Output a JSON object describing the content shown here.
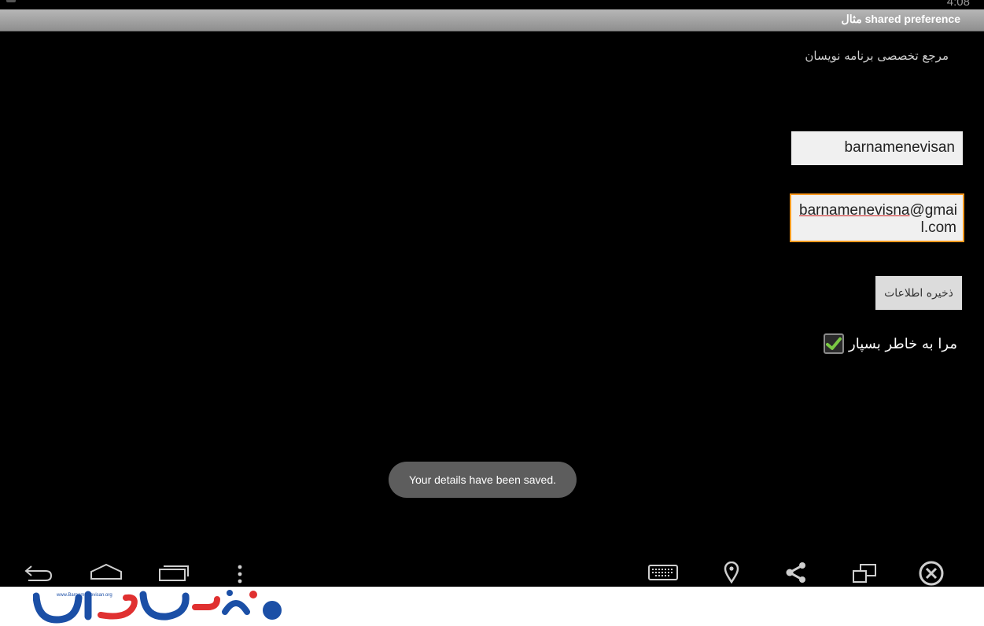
{
  "status_bar": {
    "clock": "4:08"
  },
  "app_bar": {
    "title": "مثال shared preference"
  },
  "main": {
    "subtitle": "مرجع تخصصی برنامه نویسان",
    "name_value": "barnamenevisan",
    "email_value_line1_underlined": "barnamenevisna",
    "email_value_line1_rest": "@gmai",
    "email_value_line2": "l.com",
    "save_button_label": "ذخیره اطلاعات",
    "remember_label": "مرا به خاطر بسپار",
    "remember_checked": true
  },
  "toast": {
    "message": "Your details have been saved."
  },
  "nav_bar": {
    "left_icons": [
      "back-icon",
      "home-icon",
      "recent-apps-icon",
      "menu-icon"
    ],
    "right_icons": [
      "keyboard-icon",
      "location-icon",
      "share-icon",
      "screen-rotate-icon",
      "close-icon"
    ]
  },
  "footer": {
    "logo_url": "www.BarnameNevisan.org"
  },
  "colors": {
    "accent_orange": "#ff9a1f",
    "check_green": "#7ac943",
    "logo_blue": "#1b4fa6",
    "logo_red": "#e03030"
  }
}
